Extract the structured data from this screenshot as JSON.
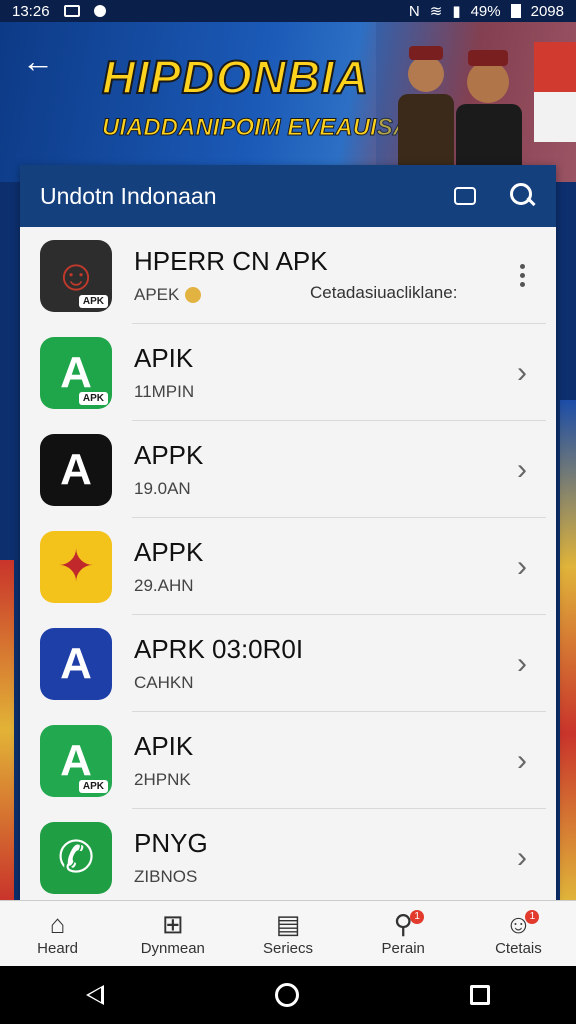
{
  "status_bar": {
    "time": "13:26",
    "battery": "49%",
    "clock_right": "2098"
  },
  "banner": {
    "title": "HIPDONBIA",
    "subtitle": "UIADDANIPOIM EVEAUISA"
  },
  "card": {
    "title": "Undotn Indonaan"
  },
  "apps": [
    {
      "name": "HPERR CN APK",
      "sub": "APEK",
      "extra": "Cetadasiuacliklane:",
      "icon_color": "#c0392b",
      "icon_bg": "#2d2d2d",
      "glyph": "☺",
      "tag": "APK",
      "action": "kebab"
    },
    {
      "name": "APIK",
      "sub": "11MPIN",
      "icon_color": "#ffffff",
      "icon_bg": "#1fa64a",
      "glyph": "A",
      "tag": "APK",
      "action": "chevron"
    },
    {
      "name": "APPK",
      "sub": "19.0AN",
      "icon_color": "#ffffff",
      "icon_bg": "#111111",
      "glyph": "A",
      "tag": "",
      "action": "chevron"
    },
    {
      "name": "APPK",
      "sub": "29.AHN",
      "icon_color": "#c0282b",
      "icon_bg": "#f3c21b",
      "glyph": "✦",
      "tag": "",
      "action": "chevron"
    },
    {
      "name": "APRK 03:0R0I",
      "sub": "CAHKN",
      "icon_color": "#ffffff",
      "icon_bg": "#1e3ea8",
      "glyph": "A",
      "tag": "",
      "action": "chevron"
    },
    {
      "name": "APIK",
      "sub": "2HPNK",
      "icon_color": "#ffffff",
      "icon_bg": "#22a84f",
      "glyph": "A",
      "tag": "APK",
      "action": "chevron"
    },
    {
      "name": "PNYG",
      "sub": "ZIBNOS",
      "icon_color": "#ffffff",
      "icon_bg": "#1f9e43",
      "glyph": "✆",
      "tag": "",
      "action": "chevron"
    }
  ],
  "bottom_nav": [
    {
      "label": "Heard",
      "icon": "home-icon",
      "glyph": "⌂",
      "badge": ""
    },
    {
      "label": "Dynmean",
      "icon": "add-box-icon",
      "glyph": "⊞",
      "badge": ""
    },
    {
      "label": "Seriecs",
      "icon": "briefcase-icon",
      "glyph": "▤",
      "badge": ""
    },
    {
      "label": "Perain",
      "icon": "search-badge-icon",
      "glyph": "⚲",
      "badge": "1"
    },
    {
      "label": "Ctetais",
      "icon": "profile-icon",
      "glyph": "☺",
      "badge": "1"
    }
  ]
}
